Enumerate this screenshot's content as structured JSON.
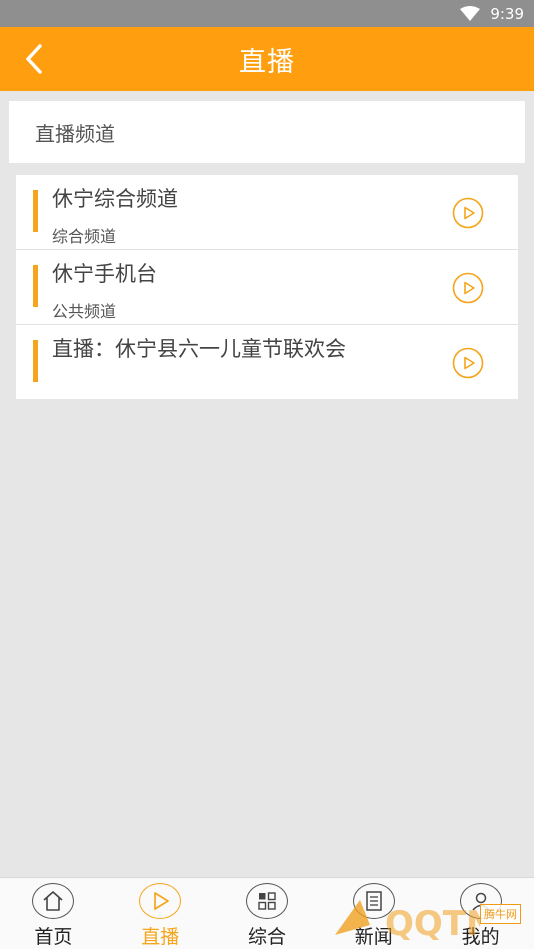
{
  "status_bar": {
    "time": "9:39",
    "wifi_icon": "wifi-icon"
  },
  "app_bar": {
    "back_icon": "back-arrow-icon",
    "title": "直播"
  },
  "section": {
    "title": "直播频道"
  },
  "channels": [
    {
      "name": "休宁综合频道",
      "subtitle": "综合频道"
    },
    {
      "name": "休宁手机台",
      "subtitle": "公共频道"
    },
    {
      "name": "直播：休宁县六一儿童节联欢会",
      "subtitle": ""
    }
  ],
  "bottom_nav": {
    "items": [
      {
        "label": "首页",
        "icon": "home-icon",
        "active": false
      },
      {
        "label": "直播",
        "icon": "play-icon",
        "active": true
      },
      {
        "label": "综合",
        "icon": "grid-icon",
        "active": false
      },
      {
        "label": "新闻",
        "icon": "news-icon",
        "active": false
      },
      {
        "label": "我的",
        "icon": "user-icon",
        "active": false
      }
    ]
  },
  "watermark": {
    "text": "腾牛网"
  },
  "colors": {
    "accent": "#ff9f0f",
    "bar": "#f5a51c",
    "background": "#e6e6e6"
  }
}
